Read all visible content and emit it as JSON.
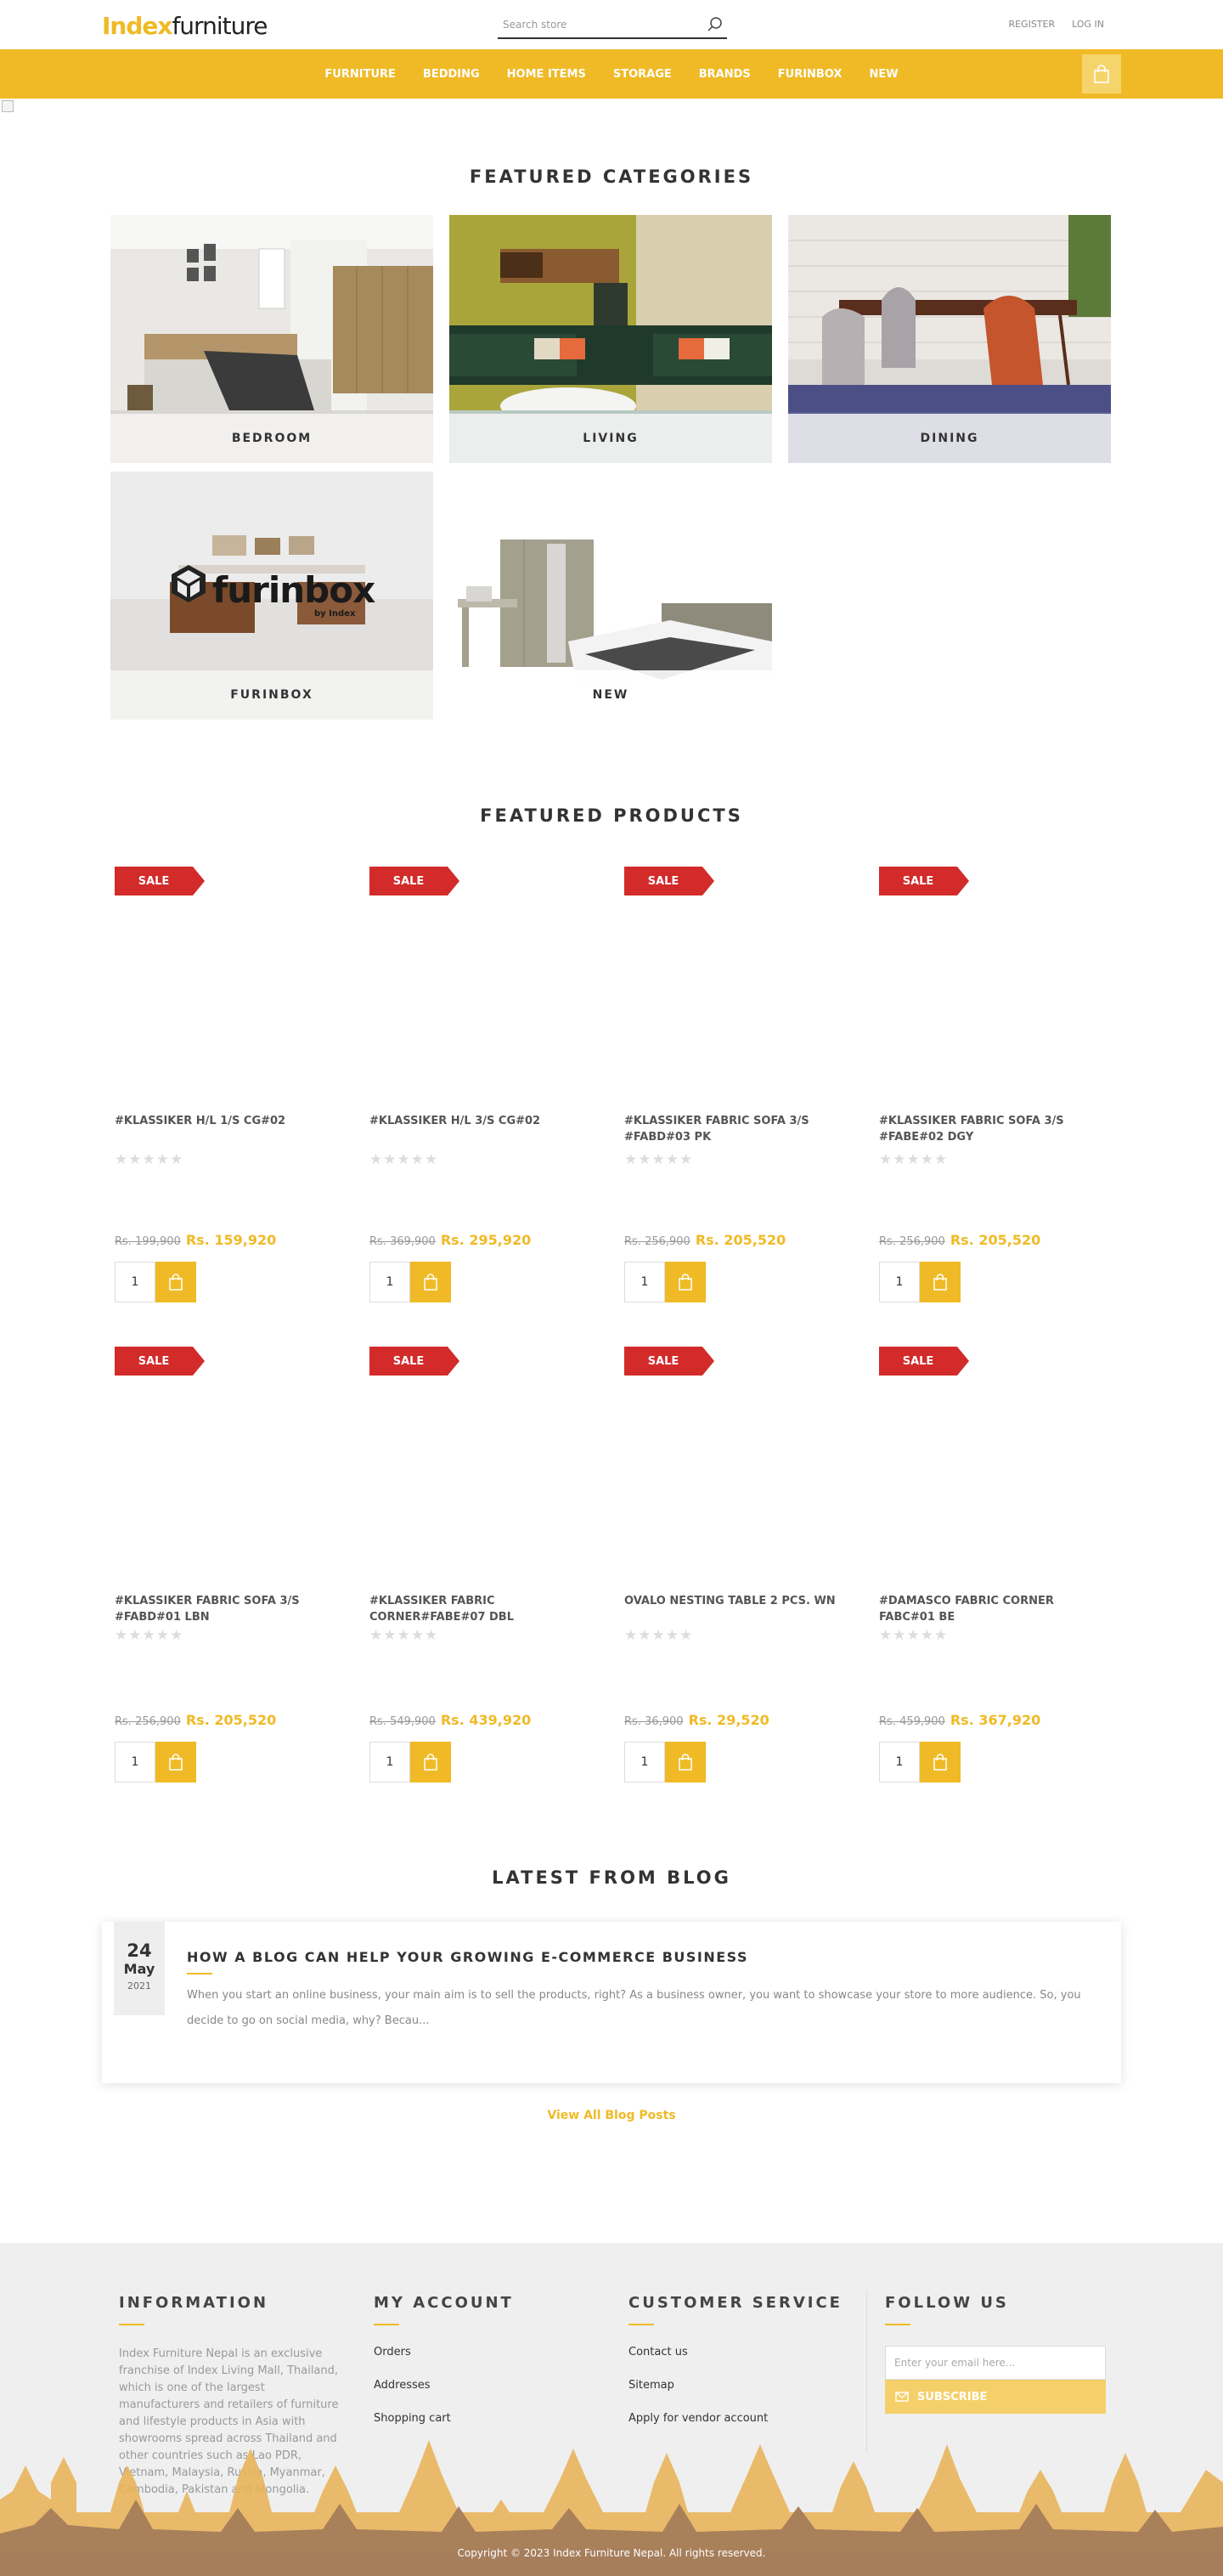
{
  "header": {
    "logo_part1": "Index",
    "logo_part2": "furniture",
    "search_placeholder": "Search store",
    "register": "REGISTER",
    "login": "LOG IN"
  },
  "nav": [
    "FURNITURE",
    "BEDDING",
    "HOME ITEMS",
    "STORAGE",
    "BRANDS",
    "FURINBOX",
    "NEW"
  ],
  "categories": {
    "title": "FEATURED CATEGORIES",
    "items": [
      {
        "label": "BEDROOM"
      },
      {
        "label": "LIVING"
      },
      {
        "label": "DINING"
      },
      {
        "label": "FURINBOX",
        "brand_text": "furinbox",
        "brand_sub": "by Index"
      },
      {
        "label": "NEW"
      }
    ]
  },
  "products": {
    "title": "FEATURED PRODUCTS",
    "sale_label": "SALE",
    "qty_default": "1",
    "items": [
      {
        "name": "#KLASSIKER H/L 1/S CG#02",
        "old_price": "Rs. 199,900",
        "new_price": "Rs. 159,920"
      },
      {
        "name": "#KLASSIKER H/L 3/S CG#02",
        "old_price": "Rs. 369,900",
        "new_price": "Rs. 295,920"
      },
      {
        "name": "#KLASSIKER FABRIC SOFA 3/S #FABD#03 PK",
        "old_price": "Rs. 256,900",
        "new_price": "Rs. 205,520"
      },
      {
        "name": "#KLASSIKER FABRIC SOFA 3/S #FABE#02 DGY",
        "old_price": "Rs. 256,900",
        "new_price": "Rs. 205,520"
      },
      {
        "name": "#KLASSIKER FABRIC SOFA 3/S #FABD#01 LBN",
        "old_price": "Rs. 256,900",
        "new_price": "Rs. 205,520"
      },
      {
        "name": "#KLASSIKER FABRIC CORNER#FABE#07 DBL",
        "old_price": "Rs. 549,900",
        "new_price": "Rs. 439,920"
      },
      {
        "name": "OVALO NESTING TABLE 2 PCS. WN",
        "old_price": "Rs. 36,900",
        "new_price": "Rs. 29,520"
      },
      {
        "name": "#DAMASCO FABRIC CORNER FABC#01 BE",
        "old_price": "Rs. 459,900",
        "new_price": "Rs. 367,920"
      }
    ]
  },
  "blog": {
    "title": "LATEST FROM BLOG",
    "day": "24",
    "month": "May",
    "year": "2021",
    "post_title": "HOW A BLOG CAN HELP YOUR GROWING E-COMMERCE BUSINESS",
    "excerpt": "When you start an online business, your main aim is to sell the products, right? As a business owner, you want to showcase your store to more audience. So, you decide to go on social media, why? Becau...",
    "view_all": "View All Blog Posts"
  },
  "footer": {
    "information_title": "INFORMATION",
    "information_text": "Index Furniture Nepal is an exclusive franchise of Index Living Mall, Thailand, which is one of the largest manufacturers and retailers of furniture and lifestyle products in Asia with showrooms spread across Thailand and other countries such as Lao PDR, Vietnam, Malaysia, Russia, Myanmar, Cambodia, Pakistan and Mongolia.",
    "account_title": "MY ACCOUNT",
    "account_links": [
      "Orders",
      "Addresses",
      "Shopping cart"
    ],
    "service_title": "CUSTOMER SERVICE",
    "service_links": [
      "Contact us",
      "Sitemap",
      "Apply for vendor account"
    ],
    "follow_title": "FOLLOW US",
    "email_placeholder": "Enter your email here...",
    "subscribe": "SUBSCRIBE",
    "copyright": "Copyright © 2023 Index Furniture Nepal. All rights reserved."
  },
  "colors": {
    "accent": "#f0ba26",
    "sale": "#d32a2a"
  }
}
